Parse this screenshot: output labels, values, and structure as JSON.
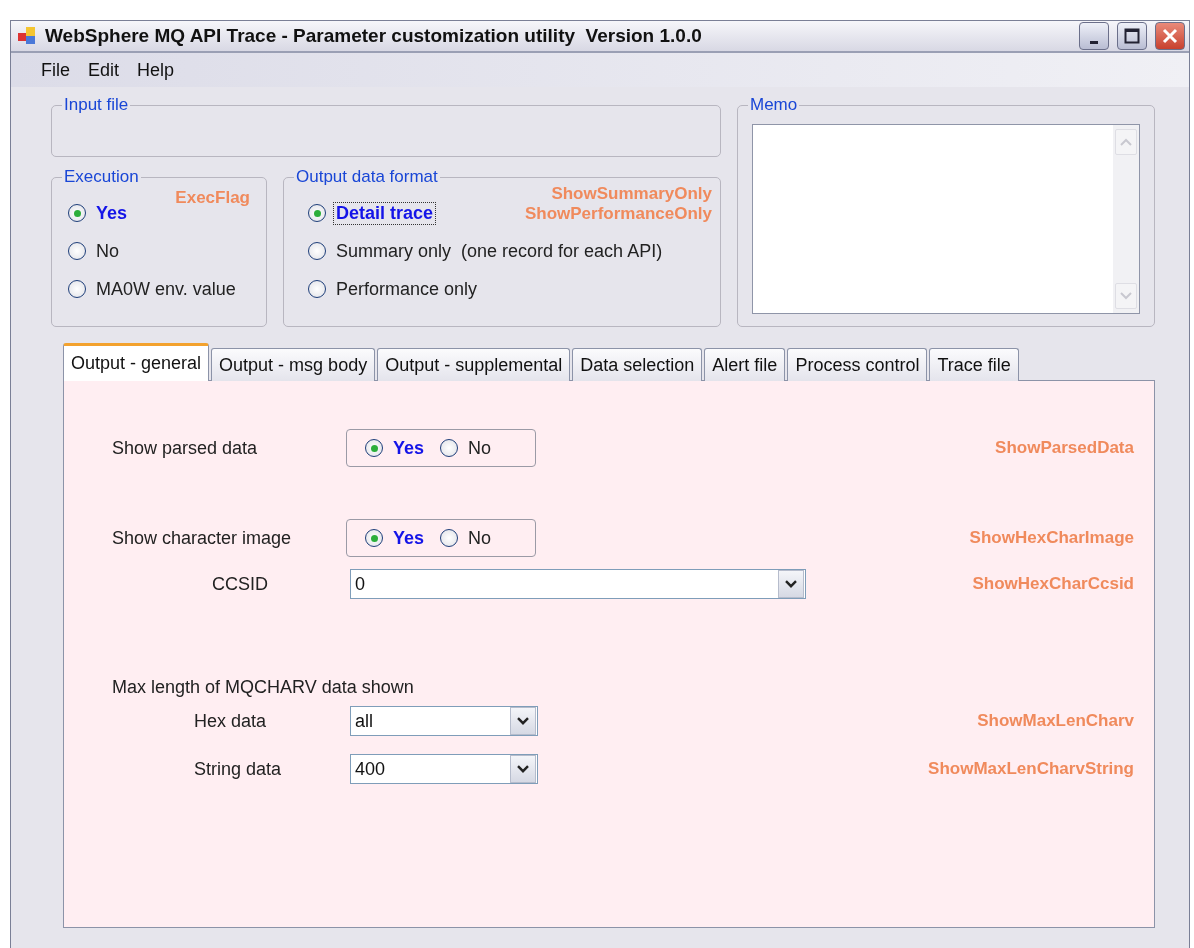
{
  "window": {
    "title": "WebSphere MQ API Trace - Parameter customization utility  Version 1.0.0"
  },
  "menu": [
    "File",
    "Edit",
    "Help"
  ],
  "input_file": {
    "label": "Input file"
  },
  "execution": {
    "label": "Execution",
    "param": "ExecFlag",
    "options": [
      {
        "label": "Yes",
        "selected": true
      },
      {
        "label": "No",
        "selected": false
      },
      {
        "label": "MA0W env. value",
        "selected": false
      }
    ]
  },
  "output_format": {
    "label": "Output data format",
    "params": [
      "ShowSummaryOnly",
      "ShowPerformanceOnly"
    ],
    "options": [
      {
        "label": "Detail trace",
        "selected": true,
        "focused": true
      },
      {
        "label": "Summary only  (one record for each API)",
        "selected": false,
        "focused": false
      },
      {
        "label": "Performance only",
        "selected": false,
        "focused": false
      }
    ]
  },
  "memo": {
    "label": "Memo"
  },
  "tabs": [
    {
      "label": "Output - general",
      "selected": true
    },
    {
      "label": "Output - msg body",
      "selected": false
    },
    {
      "label": "Output - supplemental",
      "selected": false
    },
    {
      "label": "Data selection",
      "selected": false
    },
    {
      "label": "Alert file",
      "selected": false
    },
    {
      "label": "Process control",
      "selected": false
    },
    {
      "label": "Trace file",
      "selected": false
    }
  ],
  "panel": {
    "rows": [
      {
        "kind": "radio",
        "label": "Show parsed data",
        "param": "ShowParsedData",
        "options": [
          {
            "label": "Yes",
            "selected": true
          },
          {
            "label": "No",
            "selected": false
          }
        ]
      },
      {
        "kind": "radio",
        "label": "Show character image",
        "param": "ShowHexCharImage",
        "options": [
          {
            "label": "Yes",
            "selected": true
          },
          {
            "label": "No",
            "selected": false
          }
        ]
      },
      {
        "kind": "long-combo",
        "label": "CCSID",
        "value": "0",
        "param": "ShowHexCharCcsid"
      },
      {
        "kind": "heading",
        "label": "Max length of MQCHARV data shown"
      },
      {
        "kind": "short-combo",
        "label": "Hex data",
        "value": "all",
        "param": "ShowMaxLenCharv"
      },
      {
        "kind": "short-combo",
        "label": "String data",
        "value": "400",
        "param": "ShowMaxLenCharvString"
      }
    ]
  }
}
